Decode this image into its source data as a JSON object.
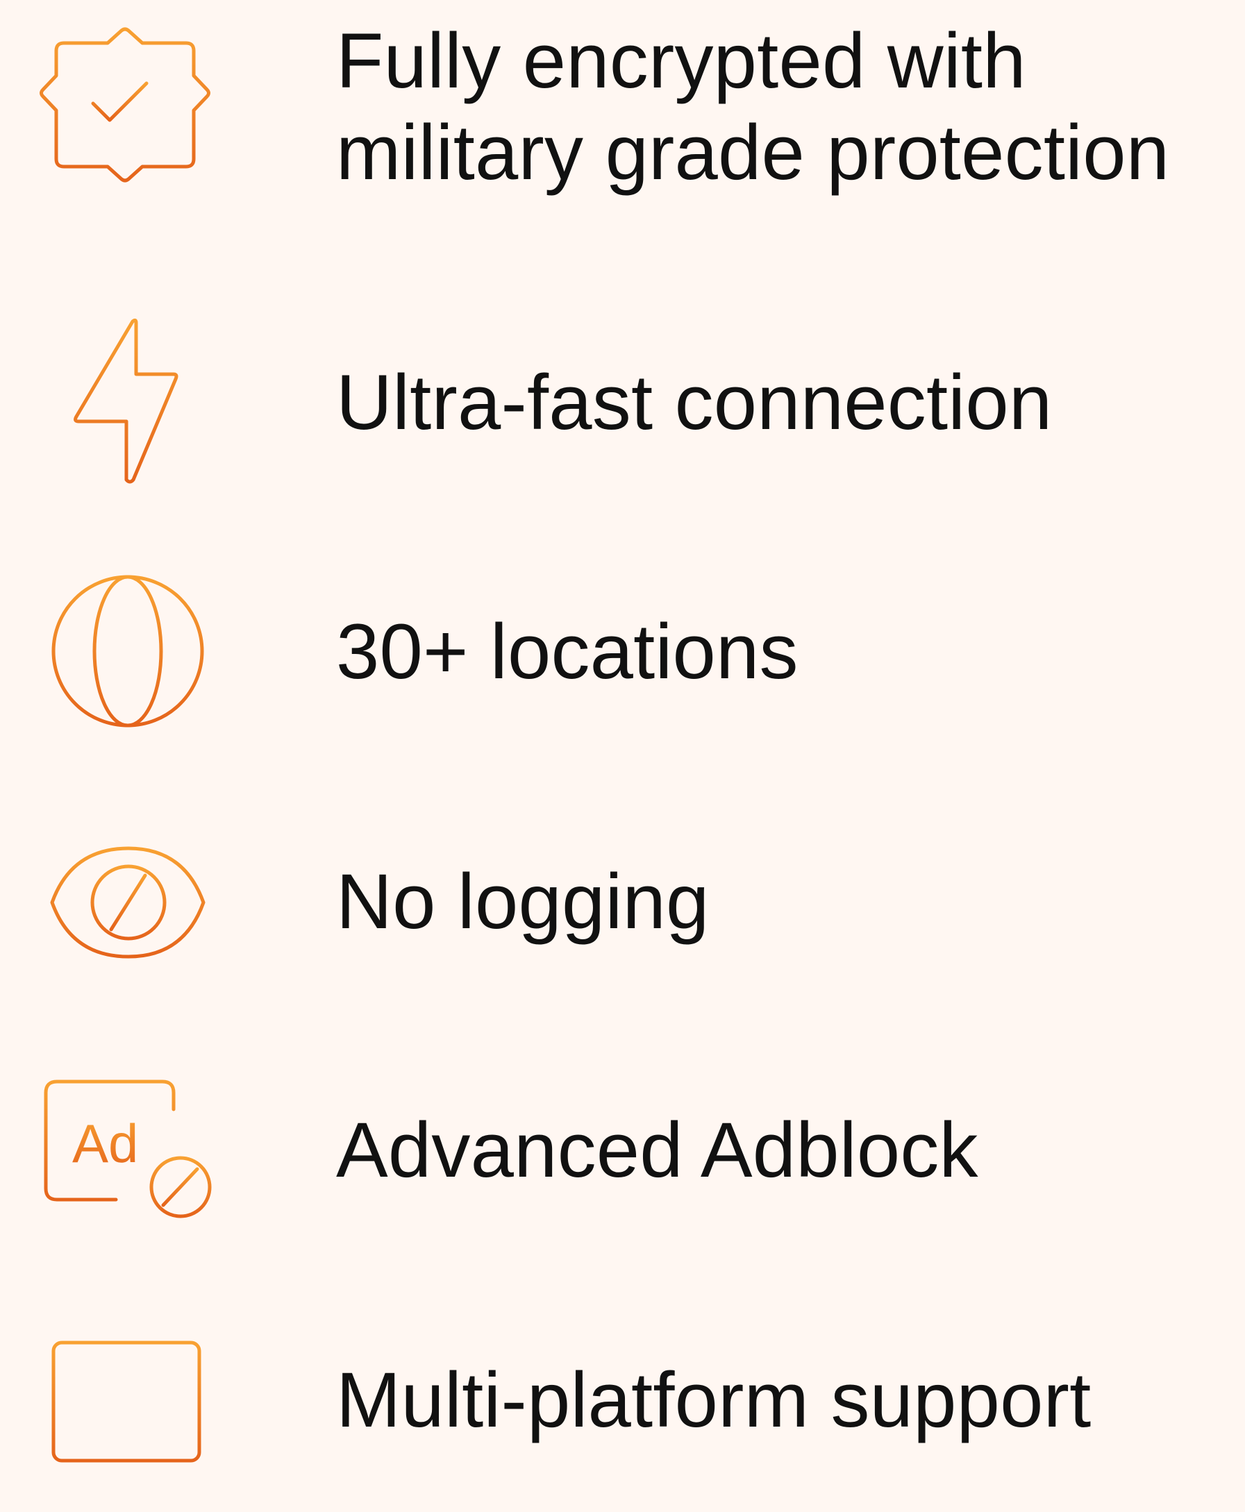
{
  "colors": {
    "background": "#fff7f2",
    "text": "#111111",
    "icon_gradient_start": "#f8a132",
    "icon_gradient_end": "#e5641b"
  },
  "features": [
    {
      "icon": "verified-badge-icon",
      "label_line_1": "Fully encrypted with",
      "label_line_2": "military grade protection"
    },
    {
      "icon": "lightning-bolt-icon",
      "label": "Ultra-fast connection"
    },
    {
      "icon": "globe-icon",
      "label": "30+ locations"
    },
    {
      "icon": "eye-slash-icon",
      "label": "No logging"
    },
    {
      "icon": "ad-block-icon",
      "icon_text": "Ad",
      "label": "Advanced Adblock"
    },
    {
      "icon": "browser-window-icon",
      "label": "Multi-platform support"
    }
  ]
}
